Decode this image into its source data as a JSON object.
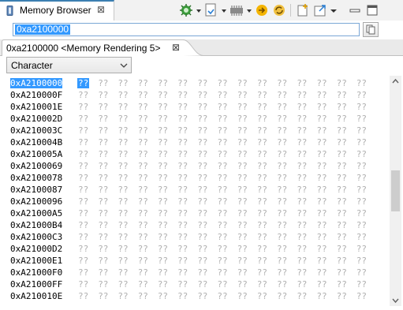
{
  "view": {
    "title": "Memory Browser",
    "close": "⊠"
  },
  "address": {
    "value": "0xa2100000"
  },
  "rendering_tab": {
    "label": "0xa2100000 <Memory Rendering 5>",
    "close": "⊠"
  },
  "format_combo": {
    "selected": "Character"
  },
  "memory": {
    "unknown": "??",
    "columns_per_row": 15,
    "addresses": [
      "0xA2100000",
      "0xA210000F",
      "0xA210001E",
      "0xA210002D",
      "0xA210003C",
      "0xA210004B",
      "0xA210005A",
      "0xA2100069",
      "0xA2100078",
      "0xA2100087",
      "0xA2100096",
      "0xA21000A5",
      "0xA21000B4",
      "0xA21000C3",
      "0xA21000D2",
      "0xA21000E1",
      "0xA21000F0",
      "0xA21000FF",
      "0xA210010E"
    ]
  },
  "colors": {
    "selection": "#3399ff",
    "unknown_text": "#b0b0b0",
    "tab_accent": "#3c7fb1"
  },
  "icons": [
    "memory-chip-icon",
    "close-icon",
    "debug-connect-icon",
    "dropdown-icon",
    "import-memory-icon",
    "export-memory-icon",
    "go-to-address-icon",
    "refresh-icon",
    "new-tab-icon",
    "new-window-icon",
    "view-menu-icon",
    "minimize-icon",
    "maximize-icon"
  ]
}
